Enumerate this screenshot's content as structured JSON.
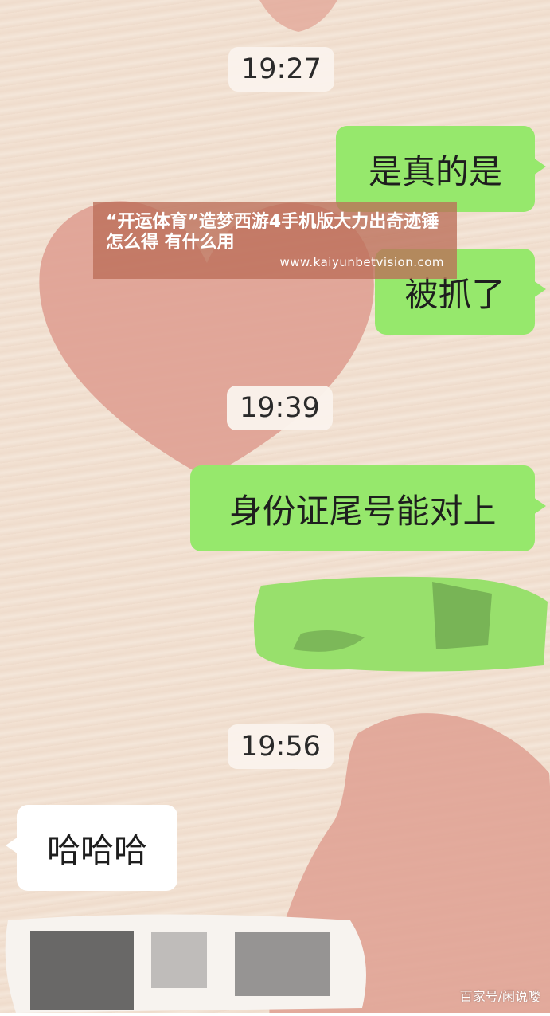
{
  "messages": {
    "time_1": "19:27",
    "msg_1": "是真的是",
    "msg_2": "被抓了",
    "time_2": "19:39",
    "msg_3": "身份证尾号能对上",
    "time_3": "19:56",
    "msg_4": "哈哈哈"
  },
  "overlay": {
    "title": "“开运体育”造梦西游4手机版大力出奇迹锤怎么得 有什么用",
    "url": "www.kaiyunbetvision.com"
  },
  "watermark": "百家号/闲说喽",
  "colors": {
    "bubble_green": "#96e86c",
    "bubble_white": "#ffffff",
    "overlay": "#bb6e58",
    "heart": "#e0a395"
  }
}
